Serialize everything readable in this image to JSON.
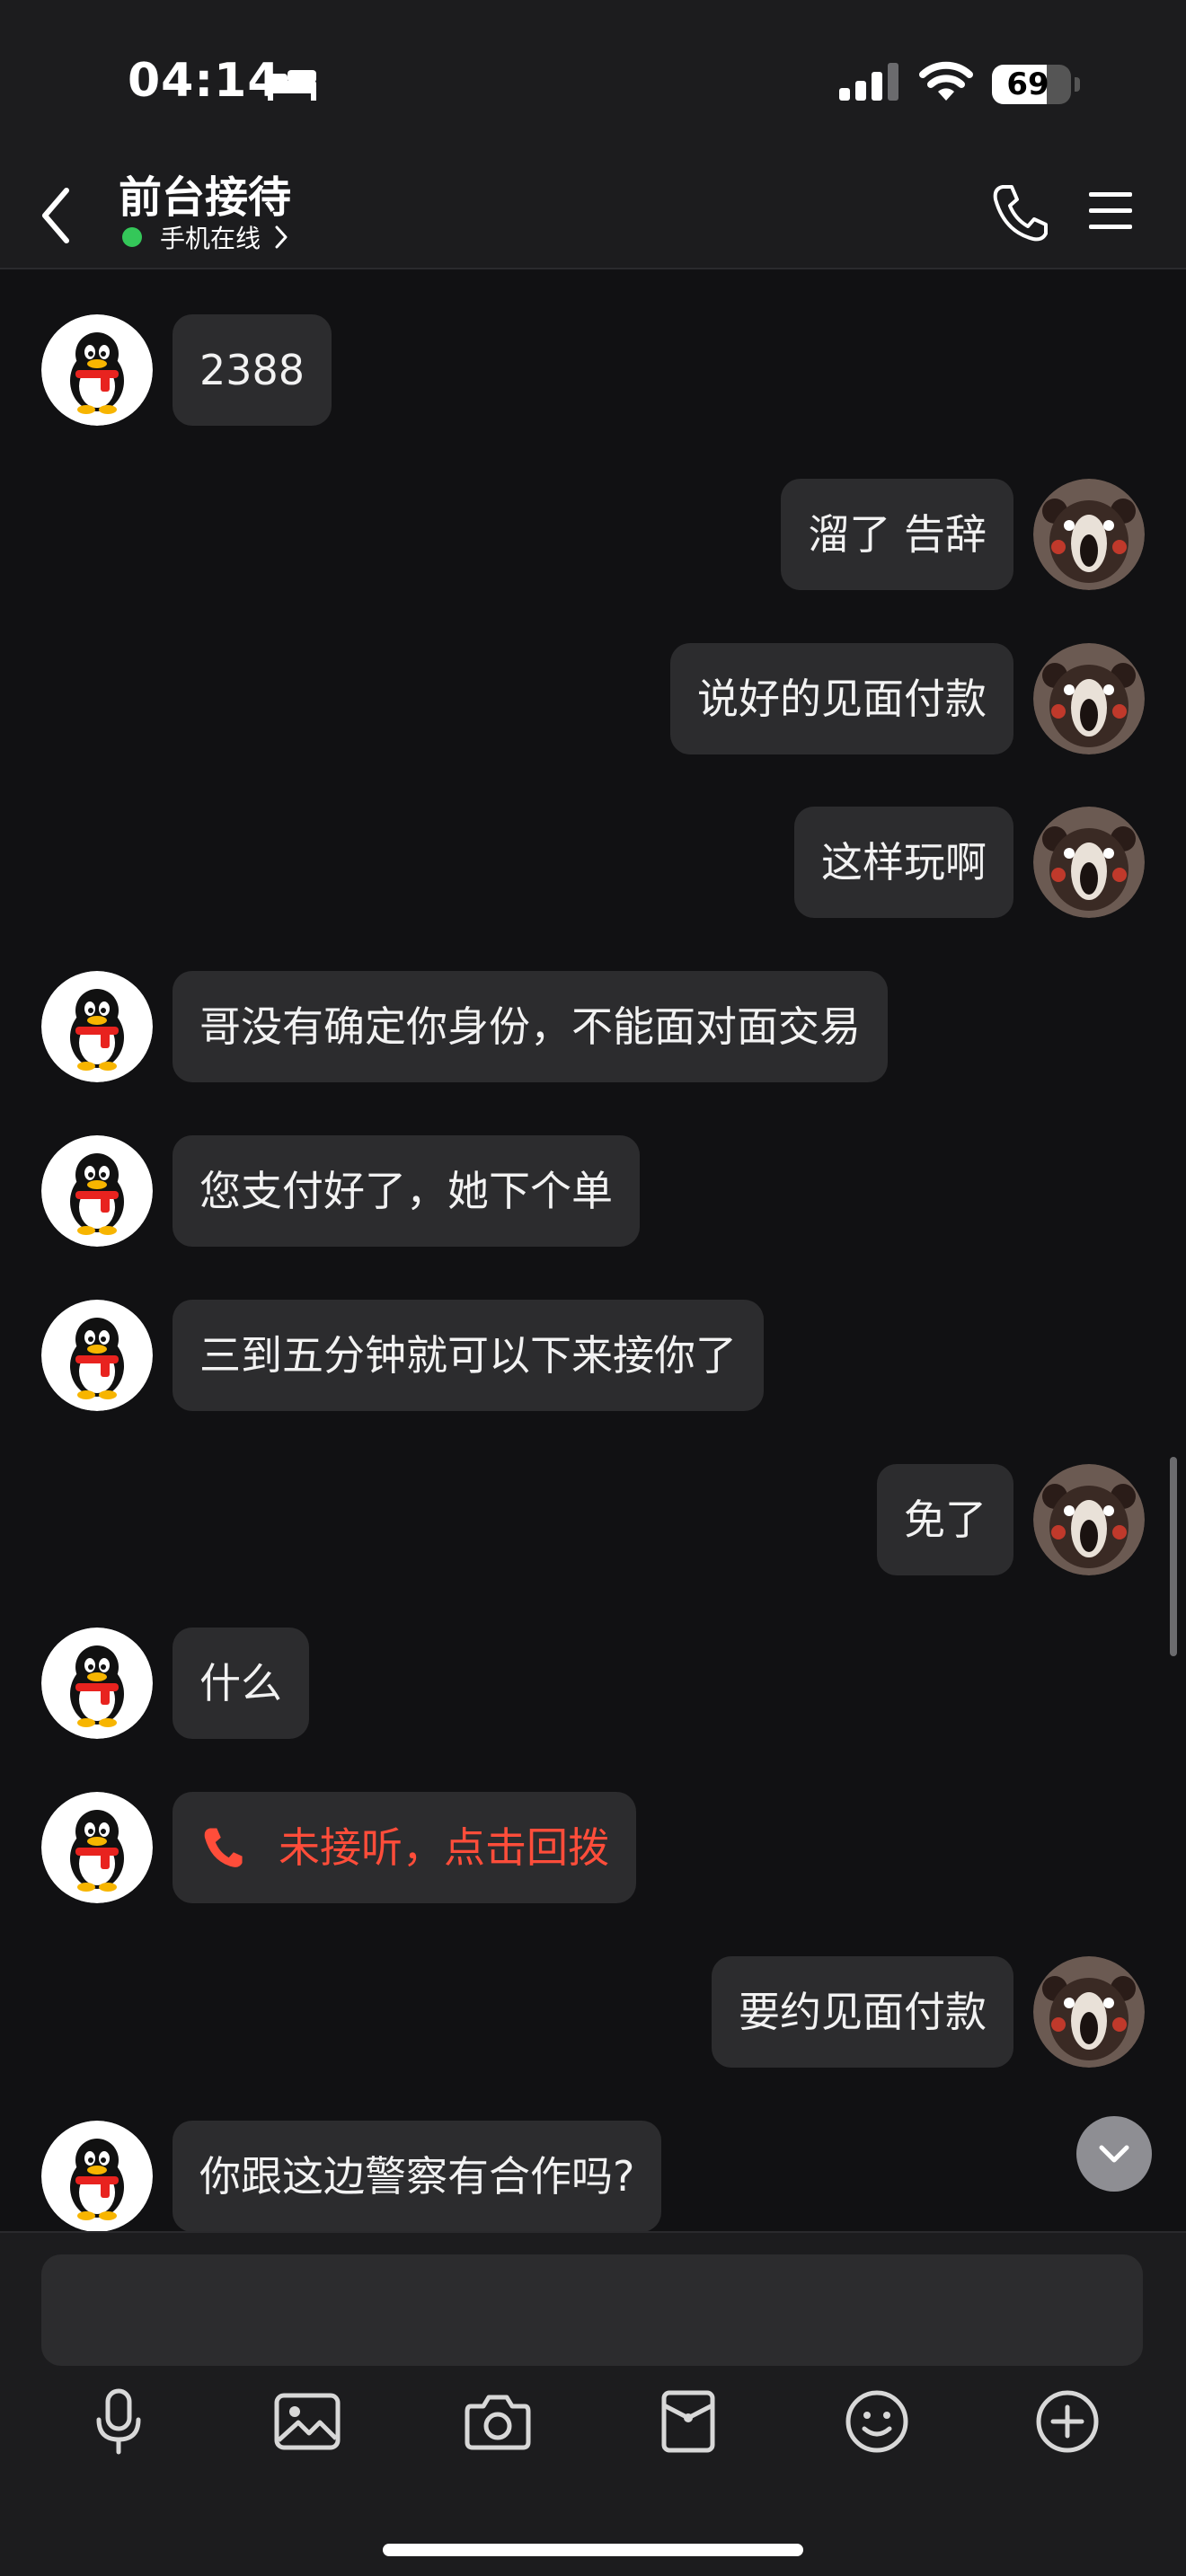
{
  "status_bar": {
    "time": "04:14",
    "battery": "69",
    "battery_level": 0.69
  },
  "header": {
    "title": "前台接待",
    "presence": "手机在线"
  },
  "messages": [
    {
      "side": "left",
      "text": "2388"
    },
    {
      "side": "right",
      "text": "溜了 告辞"
    },
    {
      "side": "right",
      "text": "说好的见面付款"
    },
    {
      "side": "right",
      "text": "这样玩啊"
    },
    {
      "side": "left",
      "text": "哥没有确定你身份，不能面对面交易"
    },
    {
      "side": "left",
      "text": "您支付好了，她下个单"
    },
    {
      "side": "left",
      "text": "三到五分钟就可以下来接你了"
    },
    {
      "side": "right",
      "text": "免了"
    },
    {
      "side": "left",
      "text": "什么"
    },
    {
      "side": "left",
      "text": "未接听，点击回拨",
      "type": "missed-call"
    },
    {
      "side": "right",
      "text": "要约见面付款"
    },
    {
      "side": "left",
      "text": "你跟这边警察有合作吗?"
    }
  ],
  "input": {
    "placeholder": ""
  },
  "toolbar": [
    "mic-icon",
    "image-icon",
    "camera-icon",
    "red-packet-icon",
    "emoji-icon",
    "plus-icon"
  ],
  "colors": {
    "background": "#111113",
    "bar": "#1c1c1e",
    "bubble": "#2c2c2e",
    "online": "#34c759",
    "missed_call": "#ff4d3a"
  }
}
